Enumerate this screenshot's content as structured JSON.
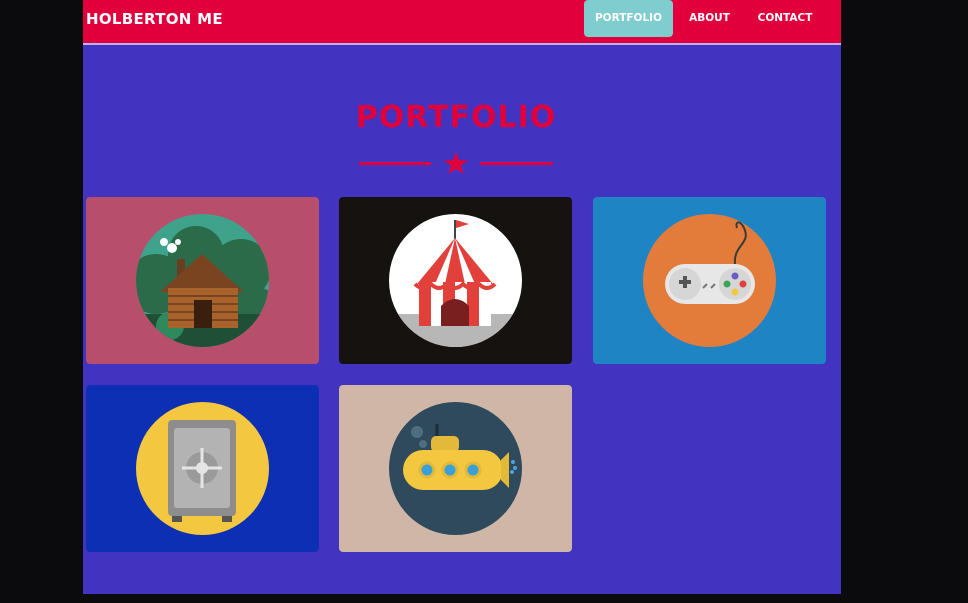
{
  "navbar": {
    "brand": "HOLBERTON ME",
    "items": [
      {
        "label": "PORTFOLIO",
        "active": true
      },
      {
        "label": "ABOUT",
        "active": false
      },
      {
        "label": "CONTACT",
        "active": false
      }
    ]
  },
  "portfolio": {
    "title": "PORTFOLIO",
    "divider_icon": "star-icon",
    "items": [
      {
        "icon": "log-cabin-icon",
        "background": "#b74f6c",
        "circle": "#3fa38c"
      },
      {
        "icon": "circus-tent-icon",
        "background": "#161210",
        "circle": "#ffffff"
      },
      {
        "icon": "game-controller-icon",
        "background": "#1e84c4",
        "circle": "#e37b3b"
      },
      {
        "icon": "safe-icon",
        "background": "#0d2fb4",
        "circle": "#f3c740"
      },
      {
        "icon": "submarine-icon",
        "background": "#d0b6a6",
        "circle": "#2e4a5c"
      }
    ]
  },
  "colors": {
    "accent": "#e2003c",
    "page_background": "#4233c0",
    "active_nav": "#7fcdce"
  }
}
